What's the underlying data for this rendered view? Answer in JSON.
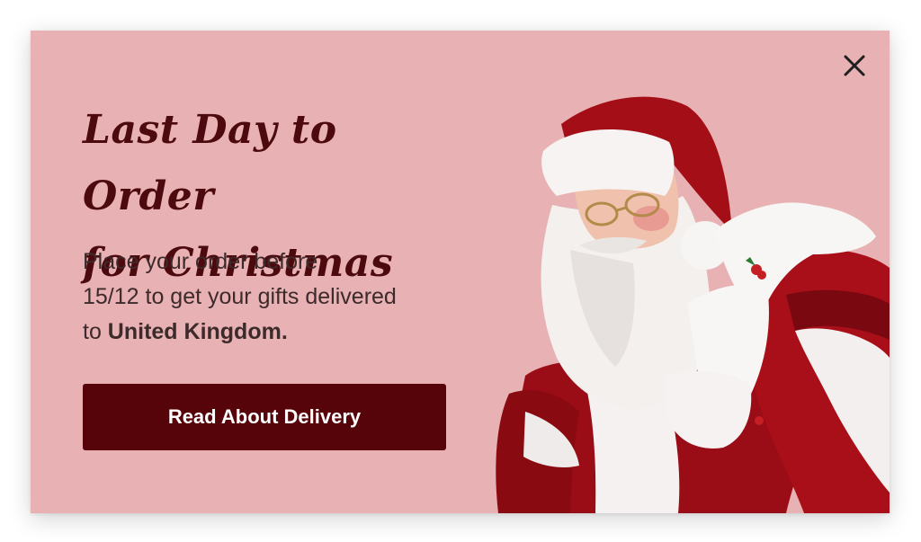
{
  "popup": {
    "headline_line1": "Last Day to Order",
    "headline_line2": "for Christmas",
    "body_line1": "Place your order before",
    "body_line2": "15/12 to get your gifts delivered",
    "body_line3_prefix": "to ",
    "body_country": "United Kingdom.",
    "cta_label": "Read About Delivery",
    "close_icon": "close-icon",
    "image": "santa-claus-photo"
  },
  "colors": {
    "background": "#e8b1b3",
    "headline": "#4d0a0e",
    "body_text": "#3d2a2b",
    "button": "#560409",
    "button_text": "#ffffff"
  }
}
